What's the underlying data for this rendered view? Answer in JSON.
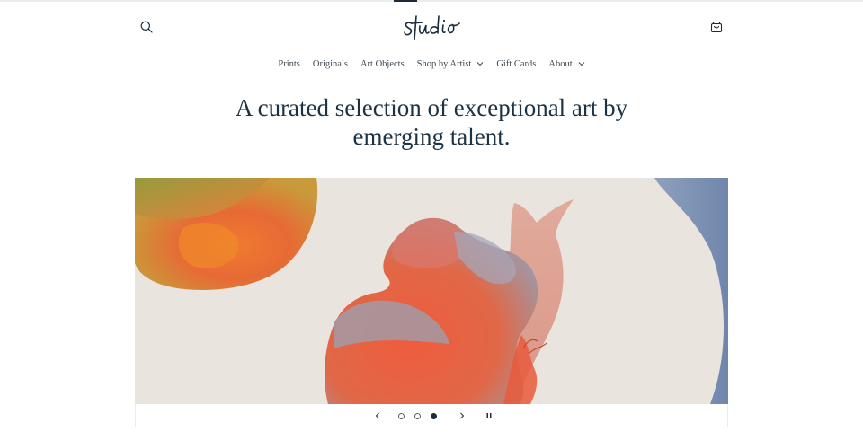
{
  "header": {
    "logo_text": "studio",
    "search_icon": "search-icon",
    "cart_icon": "cart-icon"
  },
  "nav": {
    "items": [
      {
        "label": "Prints",
        "has_dropdown": false
      },
      {
        "label": "Originals",
        "has_dropdown": false
      },
      {
        "label": "Art Objects",
        "has_dropdown": false
      },
      {
        "label": "Shop by Artist",
        "has_dropdown": true
      },
      {
        "label": "Gift Cards",
        "has_dropdown": false
      },
      {
        "label": "About",
        "has_dropdown": true
      }
    ]
  },
  "hero": {
    "title": "A curated selection of exceptional art by emerging talent."
  },
  "slideshow": {
    "slide_count": 3,
    "active_slide": 3,
    "prev_icon": "chevron-left-icon",
    "next_icon": "chevron-right-icon",
    "pause_icon": "pause-icon"
  },
  "colors": {
    "text": "#1c2b3a",
    "paper": "#e9e5de",
    "accent_orange": "#e8683f",
    "accent_blue": "#7a8fb0"
  }
}
